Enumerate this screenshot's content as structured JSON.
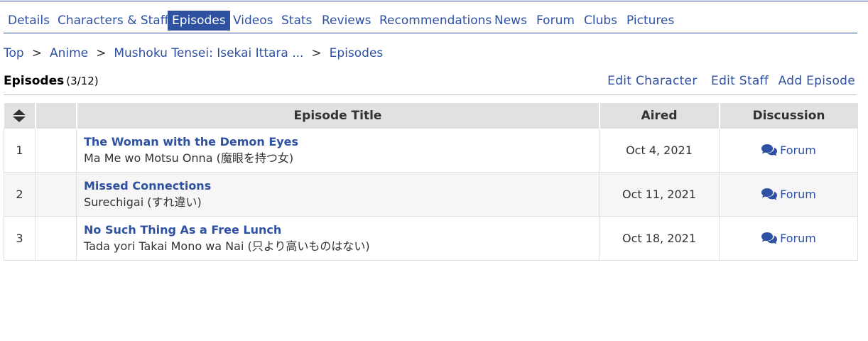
{
  "nav": {
    "tabs": [
      {
        "label": "Details"
      },
      {
        "label": "Characters & Staff"
      },
      {
        "label": "Episodes"
      },
      {
        "label": "Videos"
      },
      {
        "label": "Stats"
      },
      {
        "label": "Reviews"
      },
      {
        "label": "Recommendations"
      },
      {
        "label": "News"
      },
      {
        "label": "Forum"
      },
      {
        "label": "Clubs"
      },
      {
        "label": "Pictures"
      }
    ],
    "active": "Episodes"
  },
  "breadcrumb": {
    "items": [
      "Top",
      "Anime",
      "Mushoku Tensei: Isekai Ittara ...",
      "Episodes"
    ],
    "separator": ">"
  },
  "header": {
    "title": "Episodes",
    "count": "(3/12)",
    "links": [
      "Edit Character",
      "Edit Staff",
      "Add Episode"
    ]
  },
  "table": {
    "columns": [
      "",
      "",
      "Episode Title",
      "Aired",
      "Discussion"
    ],
    "sort_icon": "sort-up-down-icon",
    "rows": [
      {
        "number": "1",
        "title": "The Woman with the Demon Eyes",
        "title_jp": "Ma Me wo Motsu Onna (魔眼を持つ女)",
        "aired": "Oct 4, 2021",
        "discussion": "Forum"
      },
      {
        "number": "2",
        "title": "Missed Connections",
        "title_jp": "Surechigai (すれ違い)",
        "aired": "Oct 11, 2021",
        "discussion": "Forum"
      },
      {
        "number": "3",
        "title": "No Such Thing As a Free Lunch",
        "title_jp": "Tada yori Takai Mono wa Nai (只より高いものはない)",
        "aired": "Oct 18, 2021",
        "discussion": "Forum"
      }
    ]
  },
  "colors": {
    "accent": "#2e51a2",
    "header_bg": "#e1e1e1",
    "row_alt_bg": "#f6f6f6"
  }
}
